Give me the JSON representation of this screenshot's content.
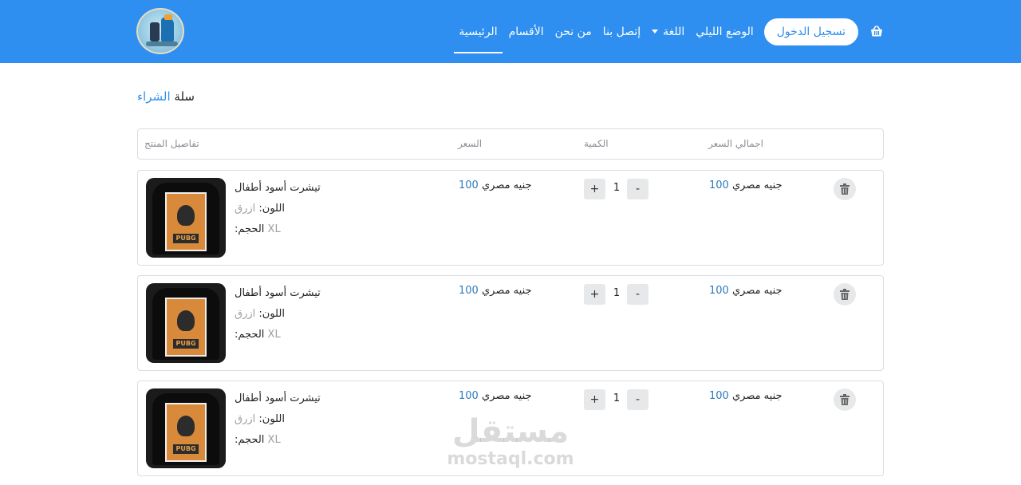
{
  "header": {
    "nav": {
      "home": "الرئيسية",
      "categories": "الأقسام",
      "about": "من نحن",
      "contact": "إتصل بنا",
      "language": "اللغة",
      "dark_mode": "الوضع الليلي",
      "login": "تسجيل الدخول"
    },
    "cart_icon": "basket-icon",
    "brand_color": "#2e8ff0"
  },
  "page": {
    "title_plain": "سلة",
    "title_accent": "الشراء"
  },
  "table": {
    "headers": {
      "details": "تفاصيل المنتج",
      "price": "السعر",
      "quantity": "الكمية",
      "total": "اجمالي السعر"
    }
  },
  "items": [
    {
      "name": "تيشرت أسود أطفال",
      "color_label": "اللون:",
      "color_value": "ازرق",
      "size_label": ":الحجم",
      "size_value": "XL",
      "price_currency": "جنيه مصري",
      "price_value": "100",
      "qty": "1",
      "plus": "+",
      "minus": "-",
      "total_currency": "جنيه مصري",
      "total_value": "100",
      "image_print": "PUBG"
    },
    {
      "name": "تيشرت أسود أطفال",
      "color_label": "اللون:",
      "color_value": "ازرق",
      "size_label": ":الحجم",
      "size_value": "XL",
      "price_currency": "جنيه مصري",
      "price_value": "100",
      "qty": "1",
      "plus": "+",
      "minus": "-",
      "total_currency": "جنيه مصري",
      "total_value": "100",
      "image_print": "PUBG"
    },
    {
      "name": "تيشرت أسود أطفال",
      "color_label": "اللون:",
      "color_value": "ازرق",
      "size_label": ":الحجم",
      "size_value": "XL",
      "price_currency": "جنيه مصري",
      "price_value": "100",
      "qty": "1",
      "plus": "+",
      "minus": "-",
      "total_currency": "جنيه مصري",
      "total_value": "100",
      "image_print": "PUBG"
    }
  ],
  "watermark": {
    "arabic": "مستقل",
    "latin": "mostaql.com"
  }
}
